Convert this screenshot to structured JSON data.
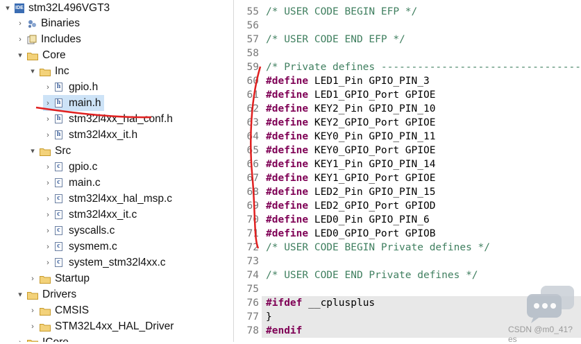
{
  "project_tree": {
    "items": [
      {
        "label": "stm32L496VGT3",
        "icon": "ide-project-icon",
        "toggle": "▾",
        "level": 0
      },
      {
        "label": "Binaries",
        "icon": "binaries-icon",
        "toggle": "›",
        "level": 1
      },
      {
        "label": "Includes",
        "icon": "includes-icon",
        "toggle": "›",
        "level": 1
      },
      {
        "label": "Core",
        "icon": "folder-icon",
        "toggle": "▾",
        "level": 1
      },
      {
        "label": "Inc",
        "icon": "folder-icon",
        "toggle": "▾",
        "level": 2
      },
      {
        "label": "gpio.h",
        "icon": "header-file-icon",
        "toggle": "›",
        "level": 3
      },
      {
        "label": "main.h",
        "icon": "header-file-icon",
        "toggle": "›",
        "level": 3,
        "selected": true
      },
      {
        "label": "stm32l4xx_hal_conf.h",
        "icon": "header-file-icon",
        "toggle": "›",
        "level": 3
      },
      {
        "label": "stm32l4xx_it.h",
        "icon": "header-file-icon",
        "toggle": "›",
        "level": 3
      },
      {
        "label": "Src",
        "icon": "folder-icon",
        "toggle": "▾",
        "level": 2
      },
      {
        "label": "gpio.c",
        "icon": "c-file-icon",
        "toggle": "›",
        "level": 3
      },
      {
        "label": "main.c",
        "icon": "c-file-icon",
        "toggle": "›",
        "level": 3
      },
      {
        "label": "stm32l4xx_hal_msp.c",
        "icon": "c-file-icon",
        "toggle": "›",
        "level": 3
      },
      {
        "label": "stm32l4xx_it.c",
        "icon": "c-file-icon",
        "toggle": "›",
        "level": 3
      },
      {
        "label": "syscalls.c",
        "icon": "c-file-icon",
        "toggle": "›",
        "level": 3
      },
      {
        "label": "sysmem.c",
        "icon": "c-file-icon",
        "toggle": "›",
        "level": 3
      },
      {
        "label": "system_stm32l4xx.c",
        "icon": "c-file-icon",
        "toggle": "›",
        "level": 3
      },
      {
        "label": "Startup",
        "icon": "folder-icon",
        "toggle": "›",
        "level": 2
      },
      {
        "label": "Drivers",
        "icon": "folder-icon",
        "toggle": "▾",
        "level": 1
      },
      {
        "label": "CMSIS",
        "icon": "folder-icon",
        "toggle": "›",
        "level": 2
      },
      {
        "label": "STM32L4xx_HAL_Driver",
        "icon": "folder-icon",
        "toggle": "›",
        "level": 2
      },
      {
        "label": "ICore",
        "icon": "folder-icon",
        "toggle": "›",
        "level": 1
      }
    ]
  },
  "editor": {
    "lines": [
      {
        "n": "55",
        "parts": [
          [
            "cm",
            "/* USER CODE BEGIN EFP */"
          ]
        ]
      },
      {
        "n": "56",
        "parts": []
      },
      {
        "n": "57",
        "parts": [
          [
            "cm",
            "/* USER CODE END EFP */"
          ]
        ]
      },
      {
        "n": "58",
        "parts": []
      },
      {
        "n": "59",
        "parts": [
          [
            "cm",
            "/* Private defines -----------------------------------------------------------*/"
          ]
        ]
      },
      {
        "n": "60",
        "parts": [
          [
            "kw",
            "#define"
          ],
          [
            "pp",
            " LED1_Pin GPIO_PIN_3"
          ]
        ]
      },
      {
        "n": "61",
        "parts": [
          [
            "kw",
            "#define"
          ],
          [
            "pp",
            " LED1_GPIO_Port GPIOE"
          ]
        ]
      },
      {
        "n": "62",
        "parts": [
          [
            "kw",
            "#define"
          ],
          [
            "pp",
            " KEY2_Pin GPIO_PIN_10"
          ]
        ]
      },
      {
        "n": "63",
        "parts": [
          [
            "kw",
            "#define"
          ],
          [
            "pp",
            " KEY2_GPIO_Port GPIOE"
          ]
        ]
      },
      {
        "n": "64",
        "parts": [
          [
            "kw",
            "#define"
          ],
          [
            "pp",
            " KEY0_Pin GPIO_PIN_11"
          ]
        ]
      },
      {
        "n": "65",
        "parts": [
          [
            "kw",
            "#define"
          ],
          [
            "pp",
            " KEY0_GPIO_Port GPIOE"
          ]
        ]
      },
      {
        "n": "66",
        "parts": [
          [
            "kw",
            "#define"
          ],
          [
            "pp",
            " KEY1_Pin GPIO_PIN_14"
          ]
        ]
      },
      {
        "n": "67",
        "parts": [
          [
            "kw",
            "#define"
          ],
          [
            "pp",
            " KEY1_GPIO_Port GPIOE"
          ]
        ]
      },
      {
        "n": "68",
        "parts": [
          [
            "kw",
            "#define"
          ],
          [
            "pp",
            " LED2_Pin GPIO_PIN_15"
          ]
        ]
      },
      {
        "n": "69",
        "parts": [
          [
            "kw",
            "#define"
          ],
          [
            "pp",
            " LED2_GPIO_Port GPIOD"
          ]
        ]
      },
      {
        "n": "70",
        "parts": [
          [
            "kw",
            "#define"
          ],
          [
            "pp",
            " LED0_Pin GPIO_PIN_6"
          ]
        ]
      },
      {
        "n": "71",
        "parts": [
          [
            "kw",
            "#define"
          ],
          [
            "pp",
            " LED0_GPIO_Port GPIOB"
          ]
        ]
      },
      {
        "n": "72",
        "parts": [
          [
            "cm",
            "/* USER CODE BEGIN Private defines */"
          ]
        ]
      },
      {
        "n": "73",
        "parts": []
      },
      {
        "n": "74",
        "parts": [
          [
            "cm",
            "/* USER CODE END Private defines */"
          ]
        ]
      },
      {
        "n": "75",
        "parts": []
      },
      {
        "n": "76",
        "parts": [
          [
            "kw",
            "#ifdef"
          ],
          [
            "pp",
            " __cplusplus"
          ]
        ]
      },
      {
        "n": "77",
        "parts": [
          [
            "pp",
            "}"
          ]
        ]
      },
      {
        "n": "78",
        "parts": [
          [
            "kw",
            "#endif"
          ]
        ]
      }
    ]
  },
  "watermark": {
    "text": "CSDN @m0_41?es"
  },
  "colors": {
    "comment": "#3f7f5f",
    "keyword": "#7f0055",
    "selection": "#cde3f7",
    "annotation": "#e02020"
  }
}
